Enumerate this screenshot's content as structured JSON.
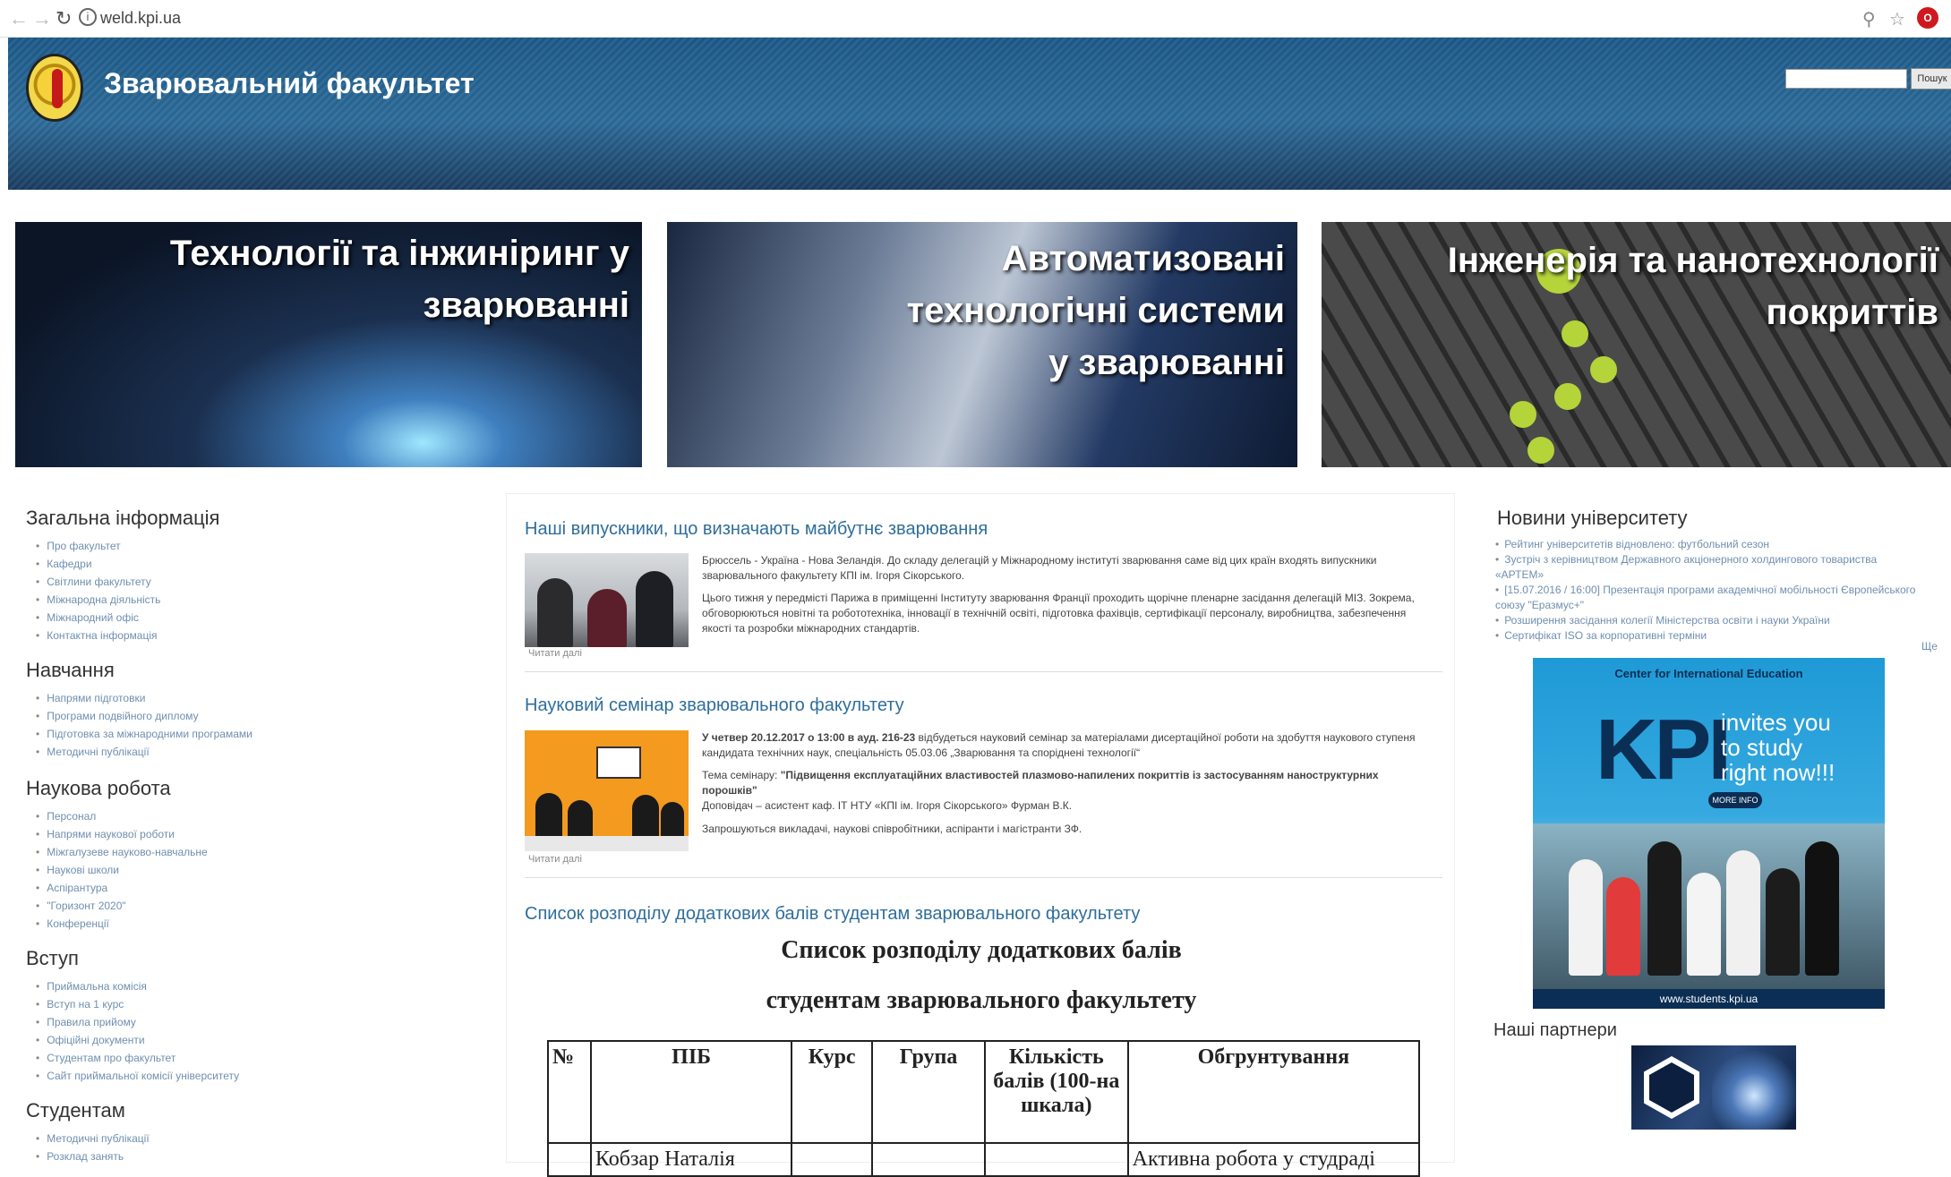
{
  "browser": {
    "url": "weld.kpi.ua"
  },
  "header": {
    "title": "Зварювальний факультет",
    "search_button": "Пошук"
  },
  "banners": [
    {
      "line1": "Технології та інжиніринг у",
      "line2": "зварюванні",
      "line3": ""
    },
    {
      "line1": "Автоматизовані",
      "line2": "технологічні системи",
      "line3": "у зварюванні"
    },
    {
      "line1": "Інженерія та нанотехнології",
      "line2": "покриттів",
      "line3": ""
    }
  ],
  "sidebar": {
    "sections": [
      {
        "title": "Загальна інформація",
        "items": [
          "Про факультет",
          "Кафедри",
          "Світлини факультету",
          "Міжнародна діяльність",
          "Міжнародний офіс",
          "Контактна інформація"
        ]
      },
      {
        "title": "Навчання",
        "items": [
          "Напрями підготовки",
          "Програми подвійного диплому",
          "Підготовка за міжнародними програмами",
          "Методичні публікації"
        ]
      },
      {
        "title": "Наукова робота",
        "items": [
          "Персонал",
          "Напрями наукової роботи",
          "Міжгалузеве науково-навчальне",
          "Наукові школи",
          "Аспірантура",
          "\"Горизонт 2020\"",
          "Конференції"
        ]
      },
      {
        "title": "Вступ",
        "items": [
          "Приймальна комісія",
          "Вступ на 1 курс",
          "Правила прийому",
          "Офіційні документи",
          "Студентам про факультет",
          "Сайт приймальної комісії університету"
        ]
      },
      {
        "title": "Студентам",
        "items": [
          "Методичні публікації",
          "Розклад занять"
        ]
      }
    ]
  },
  "articles": [
    {
      "title": "Наші випускники, що визначають майбутнє зварювання",
      "p1": "Брюссель - Україна - Нова Зеландія. До складу делегацій у Міжнародному інституті зварювання саме від цих країн входять випускники зварювального факультету КПІ ім. Ігоря Сікорського.",
      "p2": "Цього тижня у передмісті Парижа в приміщенні Інституту зварювання Франції проходить щорічне пленарне засідання делегацій МІЗ. Зокрема, обговорюються новітні та робототехніка, інновації в технічній освіті, підготовка фахівців, сертифікації персоналу, виробництва, забезпечення якості та розробки міжнародних стандартів.",
      "more": "Читати далі"
    },
    {
      "title": "Науковий семінар зварювального факультету",
      "p1_bold": "У четвер 20.12.2017 о 13:00 в ауд. 216-23",
      "p1": " відбудеться науковий семінар за матеріалами дисертаційної роботи на здобуття наукового ступеня кандидата технічних наук, спеціальність 05.03.06 „Зварювання та споріднені технології“",
      "p2_label": "Тема семінару: ",
      "p2": "\"Підвищення експлуатаційних властивостей плазмово-напилених покриттів із застосуванням наноструктурних порошків\"",
      "p3": "Доповідач – асистент каф. ІТ НТУ «КПІ ім. Ігоря Сікорського» Фурман В.К.",
      "p4": "Запрошуються викладачі, наукові співробітники, аспіранти і магістранти ЗФ.",
      "more": "Читати далі"
    },
    {
      "title": "Список розподілу додаткових балів студентам зварювального факультету",
      "doc_title1": "Список розподілу додаткових балів",
      "doc_title2": "студентам  зварювального  факультету",
      "table": {
        "headers": [
          "№",
          "ПІБ",
          "Курс",
          "Група",
          "Кількість балів (100-на шкала)",
          "Обгрунтування"
        ],
        "rows": [
          [
            "",
            "Кобзар  Наталія",
            "",
            "",
            "",
            "Активна робота у студраді"
          ]
        ]
      }
    }
  ],
  "right": {
    "news_title": "Новини університету",
    "news": [
      "Рейтинг університетів відновлено: футбольний сезон",
      "Зустріч з керівництвом Державного акціонерного холдингового товариства «АРТЕМ»",
      "[15.07.2016 / 16:00] Презентація програми академічної мобільності Європейського союзу \"Еразмус+\"",
      "Розширення засідання колегії Міністерства освіти і науки України",
      "Сертифікат ISO за корпоративні терміни"
    ],
    "all_link": "Ще",
    "ad": {
      "top": "Center for International Education",
      "kpi": "KPI",
      "invites": [
        "invites you",
        "to study",
        "right now!!!"
      ],
      "more": "MORE INFO",
      "footer": "www.students.kpi.ua"
    },
    "partners_title": "Наші партнери"
  },
  "colors": {
    "link": "#2f6e9a",
    "header": "#2a6594",
    "accent": "#b4d43a"
  }
}
